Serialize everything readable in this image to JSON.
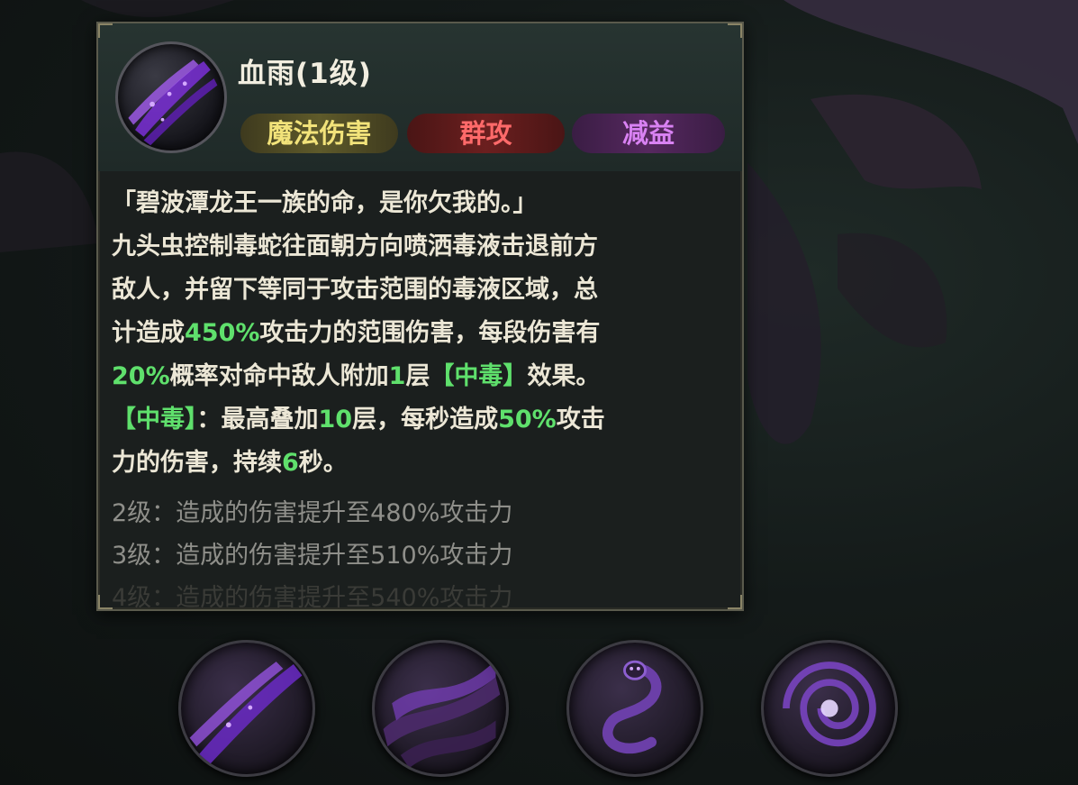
{
  "skill": {
    "title": "血雨(1级)",
    "tags": {
      "magic": "魔法伤害",
      "aoe": "群攻",
      "debuff": "减益"
    },
    "quote": "「碧波潭龙王一族的命，是你欠我的。」",
    "desc": {
      "line1": "九头虫控制毒蛇往面朝方向喷洒毒液击退前方",
      "line2": "敌人，并留下等同于攻击范围的毒液区域，总",
      "line3_a": "计造成",
      "line3_b": "450%",
      "line3_c": "攻击力的范围伤害，每段伤害有",
      "line4_a": "20%",
      "line4_b": "概率对命中敌人附加",
      "line4_c": "1",
      "line4_d": "层",
      "line4_e": "【中毒】",
      "line4_f": "效果。",
      "line5_a": "【中毒】",
      "line5_b": "：最高叠加",
      "line5_c": "10",
      "line5_d": "层，每秒造成",
      "line5_e": "50%",
      "line5_f": "攻击",
      "line6_a": "力的伤害，持续",
      "line6_b": "6",
      "line6_c": "秒。"
    },
    "levels": [
      "2级：造成的伤害提升至480%攻击力",
      "3级：造成的伤害提升至510%攻击力",
      "4级：造成的伤害提升至540%攻击力"
    ]
  },
  "colors": {
    "highlight_green": "#5fe06c",
    "tag_magic": "#f2e37a",
    "tag_aoe": "#ff6a6a",
    "tag_debuff": "#d982f3"
  },
  "bottom_skill_icons": [
    "blood-rain-icon",
    "shadow-wave-icon",
    "serpent-coil-icon",
    "dark-vortex-icon"
  ]
}
